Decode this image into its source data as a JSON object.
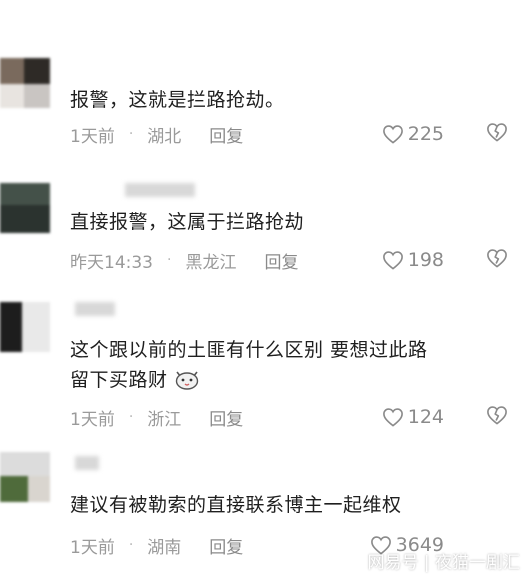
{
  "comments": [
    {
      "text": "报警，这就是拦路抢劫。",
      "time": "1天前",
      "location": "湖北",
      "reply_label": "回复",
      "likes": "225"
    },
    {
      "text": "直接报警，这属于拦路抢劫",
      "time": "昨天14:33",
      "location": "黑龙江",
      "reply_label": "回复",
      "likes": "198"
    },
    {
      "text_line1": "这个跟以前的土匪有什么区别 要想过此路",
      "text_line2": "留下买路财",
      "time": "1天前",
      "location": "浙江",
      "reply_label": "回复",
      "likes": "124"
    },
    {
      "text": "建议有被勒索的直接联系博主一起维权",
      "time": "1天前",
      "location": "湖南",
      "reply_label": "回复",
      "likes": "3649"
    }
  ],
  "meta_separator": "·",
  "watermark": "网易号 | 夜猫一剧汇",
  "icons": {
    "like": "heart-icon",
    "dislike": "broken-heart-icon",
    "emoji": "cat-face-emoji-icon"
  },
  "colors": {
    "text": "#1f1f1f",
    "meta": "#9a9a9a",
    "icon": "#8a8a8a"
  }
}
